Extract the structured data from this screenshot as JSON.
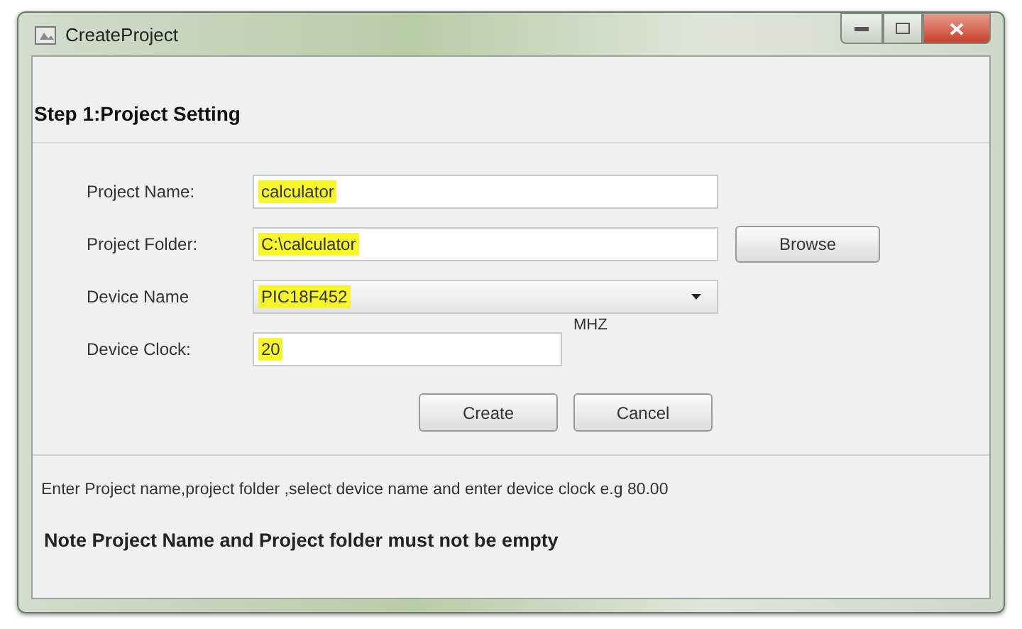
{
  "window": {
    "title": "CreateProject"
  },
  "header": "Step 1:Project Setting",
  "fields": [
    {
      "kind": "text",
      "label": "Project Name:",
      "value": "calculator",
      "highlighted": true
    },
    {
      "kind": "folder",
      "label": "Project Folder:",
      "value": "C:\\calculator",
      "highlighted": true,
      "button": "Browse"
    },
    {
      "kind": "dropdown",
      "label": "Device Name",
      "value": "PIC18F452",
      "highlighted": true
    },
    {
      "kind": "short",
      "label": "Device Clock:",
      "value": "20",
      "highlighted": true,
      "unit": "MHZ"
    }
  ],
  "buttons": [
    "Create",
    "Cancel"
  ],
  "hint": "Enter Project name,project folder ,select device name and enter device clock e.g 80.00",
  "note": "Note Project Name and Project folder must not be empty"
}
